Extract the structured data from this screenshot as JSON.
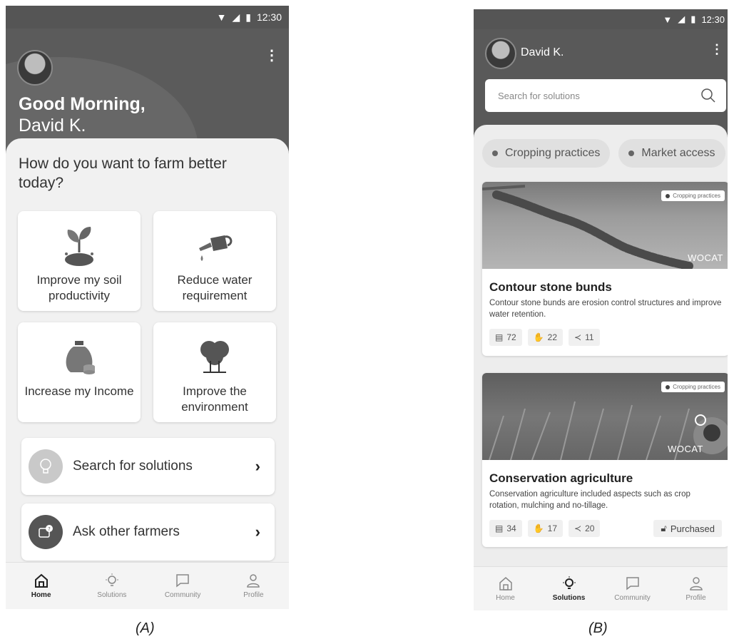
{
  "screen_a": {
    "status": {
      "time": "12:30"
    },
    "greeting": "Good Morning,",
    "user_name": "David K.",
    "question": "How do you want to farm better today?",
    "goals": [
      {
        "label": "Improve my soil productivity",
        "icon": "plant-soil-icon"
      },
      {
        "label": "Reduce water requirement",
        "icon": "watering-can-icon"
      },
      {
        "label": "Increase my Income",
        "icon": "money-bag-icon"
      },
      {
        "label": "Improve the environment",
        "icon": "trees-icon"
      }
    ],
    "actions": [
      {
        "label": "Search for solutions",
        "icon": "lightbulb-icon"
      },
      {
        "label": "Ask other farmers",
        "icon": "question-chat-icon"
      }
    ],
    "nav": [
      {
        "label": "Home",
        "icon": "home-icon",
        "active": true
      },
      {
        "label": "Solutions",
        "icon": "lightbulb-icon",
        "active": false
      },
      {
        "label": "Community",
        "icon": "chat-icon",
        "active": false
      },
      {
        "label": "Profile",
        "icon": "person-icon",
        "active": false
      }
    ],
    "caption": "(A)"
  },
  "screen_b": {
    "status": {
      "time": "12:30"
    },
    "user_name": "David K.",
    "search_placeholder": "Search for solutions",
    "chips": [
      "Cropping practices",
      "Market access"
    ],
    "cards": [
      {
        "tag": "Cropping practices",
        "watermark": "WOCAT",
        "title": "Contour stone bunds",
        "description": "Contour stone bunds are erosion control structures and improve water retention.",
        "views": "72",
        "likes": "22",
        "shares": "11"
      },
      {
        "tag": "Cropping practices",
        "watermark": "WOCAT",
        "title": "Conservation agriculture",
        "description": "Conservation agriculture included aspects such as crop rotation, mulching and no-tillage.",
        "views": "34",
        "likes": "17",
        "shares": "20",
        "purchased": "Purchased"
      }
    ],
    "nav": [
      {
        "label": "Home",
        "icon": "home-icon",
        "active": false
      },
      {
        "label": "Solutions",
        "icon": "lightbulb-icon",
        "active": true
      },
      {
        "label": "Community",
        "icon": "chat-icon",
        "active": false
      },
      {
        "label": "Profile",
        "icon": "person-icon",
        "active": false
      }
    ],
    "caption": "(B)"
  }
}
